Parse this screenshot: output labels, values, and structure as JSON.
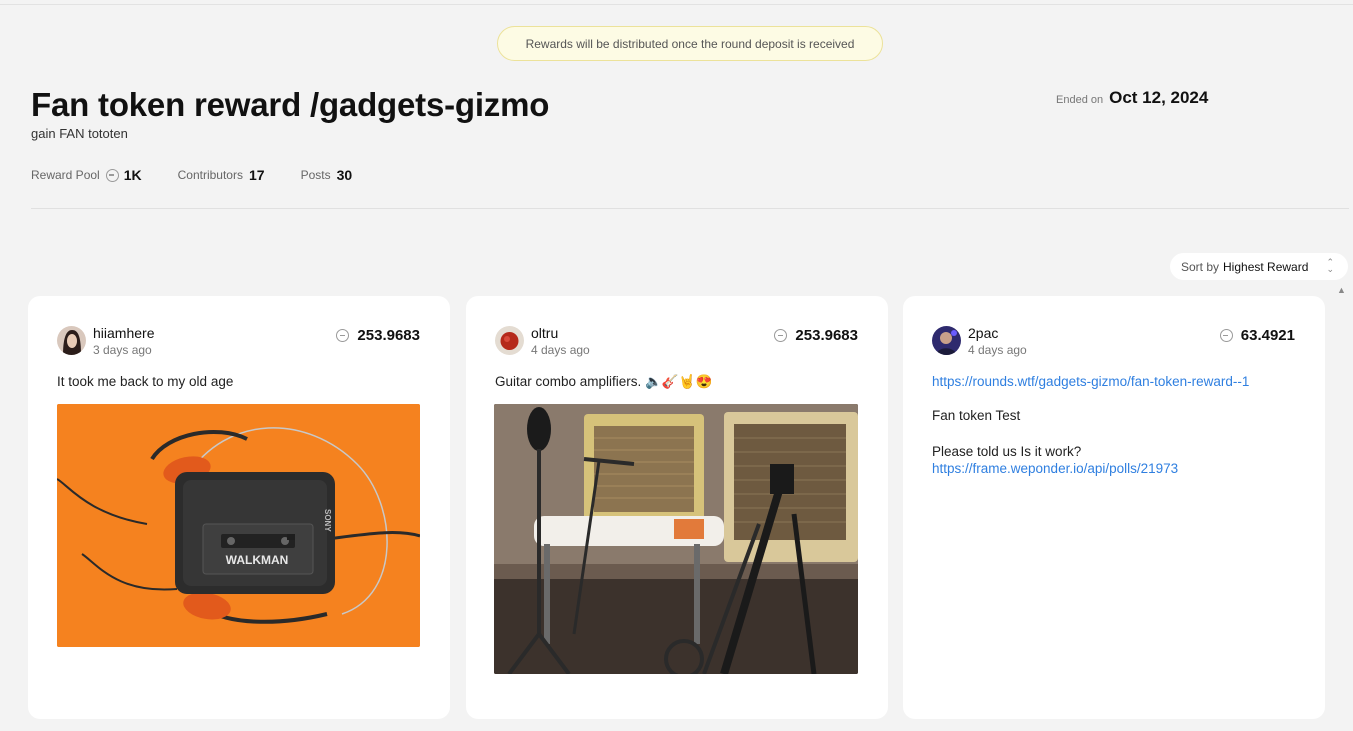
{
  "banner": {
    "text": "Rewards will be distributed once the round deposit is received"
  },
  "header": {
    "title": "Fan token reward /gadgets-gizmo",
    "subtitle": "gain FAN tototen",
    "ended_label": "Ended on",
    "ended_date": "Oct 12, 2024"
  },
  "stats": {
    "reward_pool_label": "Reward Pool",
    "reward_pool_value": "1K",
    "contributors_label": "Contributors",
    "contributors_value": "17",
    "posts_label": "Posts",
    "posts_value": "30"
  },
  "sort": {
    "label": "Sort by",
    "value": "Highest Reward"
  },
  "posts": [
    {
      "username": "hiiamhere",
      "time_ago": "3 days ago",
      "reward": "253.9683",
      "text": "It took me back to my old age",
      "image_text": {
        "brand": "SONY",
        "product": "WALKMAN"
      }
    },
    {
      "username": "oltru",
      "time_ago": "4 days ago",
      "reward": "253.9683",
      "text": "Guitar combo amplifiers. 🔈🎸🤘😍"
    },
    {
      "username": "2pac",
      "time_ago": "4 days ago",
      "reward": "63.4921",
      "link1": "https://rounds.wtf/gadgets-gizmo/fan-token-reward--1",
      "line2": "Fan token Test",
      "line3": "Please told us Is it work?",
      "link2": "https://frame.weponder.io/api/polls/21973"
    }
  ],
  "colors": {
    "link": "#2f7fe0",
    "banner_bg": "#fdfbe4",
    "banner_border": "#ece29a",
    "walkman_bg": "#f5821f"
  }
}
